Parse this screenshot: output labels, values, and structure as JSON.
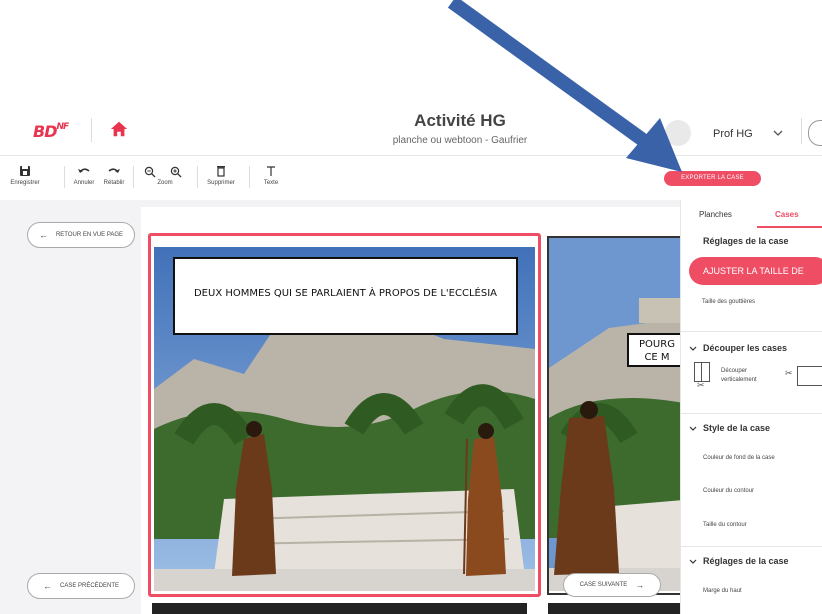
{
  "header": {
    "logo": "BD",
    "logo_sup": "NF",
    "title": "Activité HG",
    "subtitle": "planche ou webtoon - Gaufrier",
    "user_name": "Prof HG"
  },
  "toolbar": {
    "save": "Enregistrer",
    "undo": "Annuler",
    "redo": "Rétablir",
    "zoom": "Zoom",
    "delete": "Supprimer",
    "text": "Texte",
    "export": "EXPORTER LA CASE"
  },
  "nav": {
    "back_to_page": "RETOUR EN VUE PAGE",
    "previous_case": "CASE PRÉCÉDENTE",
    "next_case": "CASE SUIVANTE"
  },
  "panels": [
    {
      "caption": "DEUX HOMMES QUI SE PARLAIENT À PROPOS DE L'ECCLÉSIA"
    },
    {
      "bubble_line1": "POURG",
      "bubble_line2": "CE M"
    }
  ],
  "side_panel": {
    "tabs": [
      "Planches",
      "Cases"
    ],
    "active_tab": "Cases",
    "case_settings_title": "Réglages de la case",
    "adjust_button": "AJUSTER LA TAILLE DE",
    "gutter_size": "Taille des gouttières",
    "cut_section": "Découper les cases",
    "cut_vertical": "Découper verticalement",
    "style_section": "Style de la case",
    "bg_color": "Couleur de fond de la case",
    "border_color": "Couleur du contour",
    "border_size": "Taille du contour",
    "settings_section_2": "Réglages de la case",
    "top_margin": "Marge du haut"
  },
  "colors": {
    "accent": "#ee4d63",
    "arrow": "#3a62a8"
  }
}
